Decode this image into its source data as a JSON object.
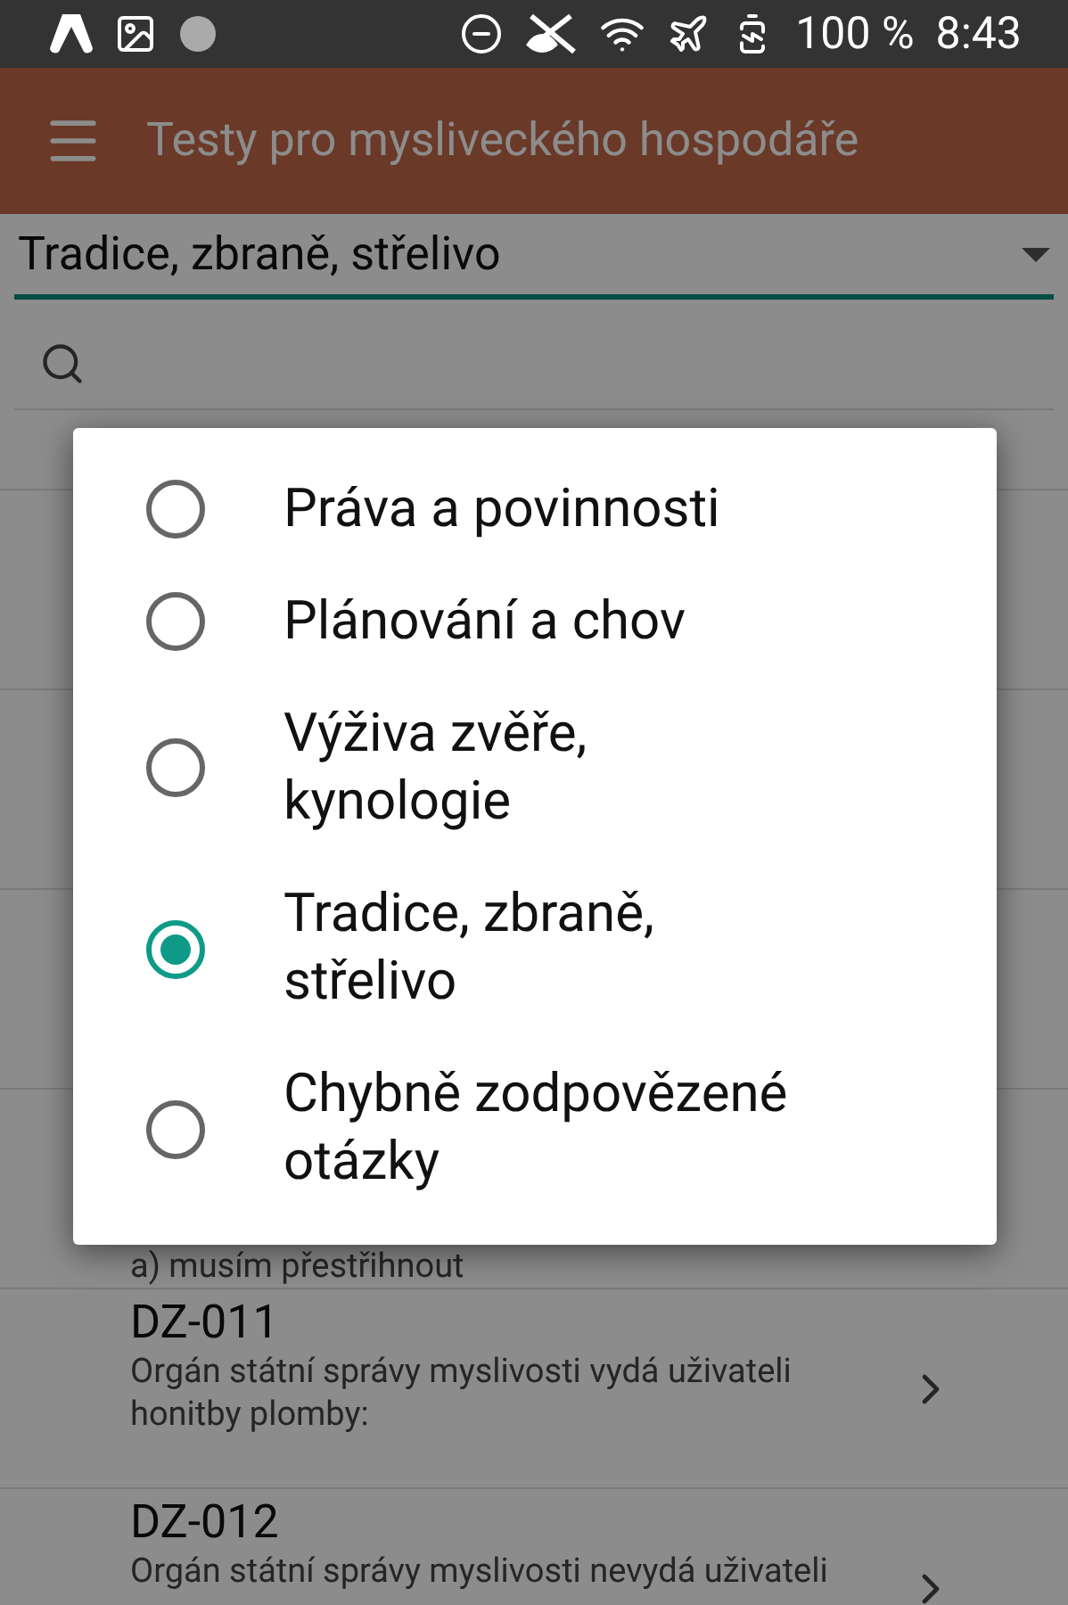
{
  "status_bar": {
    "battery": "100 %",
    "time": "8:43"
  },
  "app_bar": {
    "title": "Testy pro mysliveckého hospodáře"
  },
  "category_spinner": {
    "value": "Tradice, zbraně, střelivo"
  },
  "list": {
    "partial_text": "a) musím přestřihnout",
    "rows": [
      {
        "code": "DZ-011",
        "question": "Orgán státní správy myslivosti vydá uživateli honitby plomby:"
      },
      {
        "code": "DZ-012",
        "question": "Orgán státní správy myslivosti nevydá uživateli"
      }
    ]
  },
  "dialog": {
    "options": [
      {
        "label": "Práva a povinnosti",
        "selected": false
      },
      {
        "label": "Plánování a chov",
        "selected": false
      },
      {
        "label": "Výživa zvěře, kynologie",
        "selected": false
      },
      {
        "label": "Tradice, zbraně, střelivo",
        "selected": true
      },
      {
        "label": "Chybně zodpovězené otázky",
        "selected": false
      }
    ]
  }
}
